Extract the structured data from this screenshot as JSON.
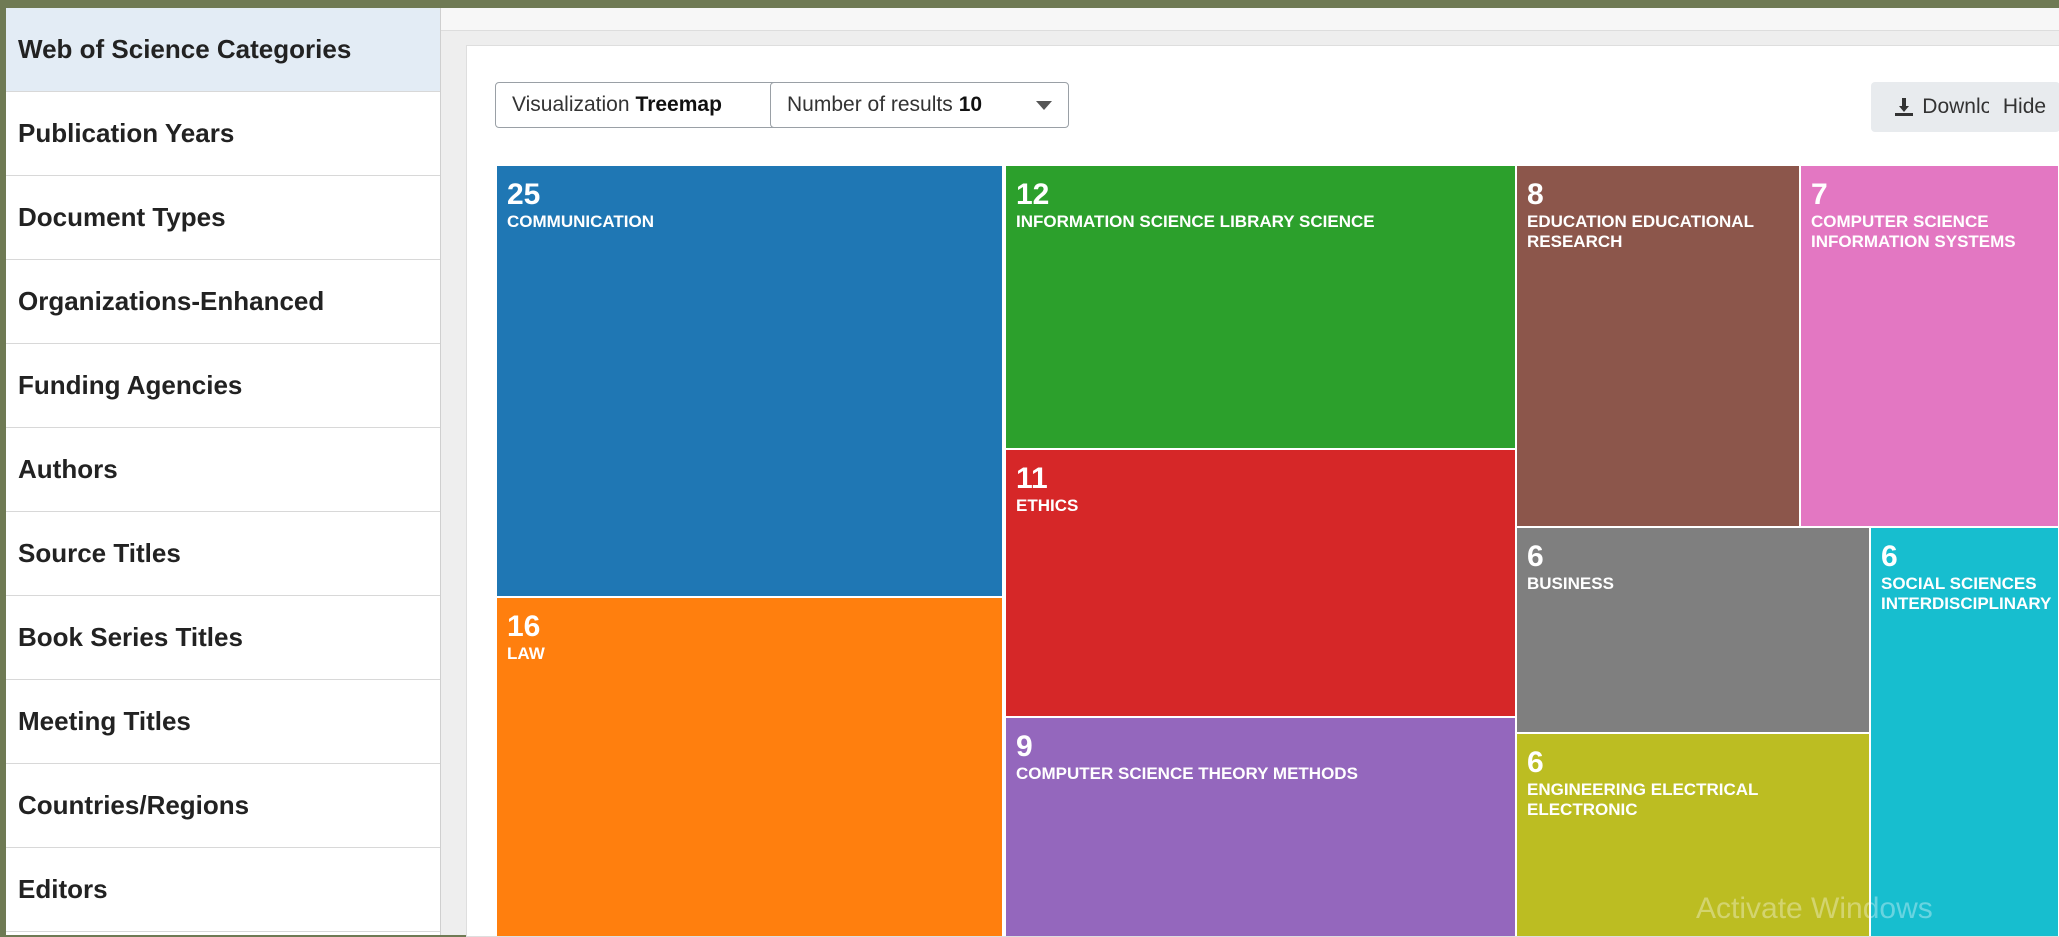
{
  "sidebar": {
    "items": [
      {
        "label": "Web of Science Categories",
        "active": true
      },
      {
        "label": "Publication Years"
      },
      {
        "label": "Document Types"
      },
      {
        "label": "Organizations-Enhanced"
      },
      {
        "label": "Funding Agencies"
      },
      {
        "label": "Authors"
      },
      {
        "label": "Source Titles"
      },
      {
        "label": "Book Series Titles"
      },
      {
        "label": "Meeting Titles"
      },
      {
        "label": "Countries/Regions"
      },
      {
        "label": "Editors"
      }
    ]
  },
  "controls": {
    "visualization_label": "Visualization",
    "visualization_value": "Treemap",
    "results_label": "Number of results",
    "results_value": "10",
    "download_label": "Download",
    "hide_label": "Hide"
  },
  "chart_data": {
    "type": "treemap",
    "items": [
      {
        "count": 25,
        "label": "COMMUNICATION",
        "color": "#1f77b4"
      },
      {
        "count": 16,
        "label": "LAW",
        "color": "#ff7f0e"
      },
      {
        "count": 12,
        "label": "INFORMATION SCIENCE LIBRARY SCIENCE",
        "color": "#2ca02c"
      },
      {
        "count": 11,
        "label": "ETHICS",
        "color": "#d62728"
      },
      {
        "count": 9,
        "label": "COMPUTER SCIENCE THEORY METHODS",
        "color": "#9467bd"
      },
      {
        "count": 8,
        "label": "EDUCATION EDUCATIONAL RESEARCH",
        "color": "#8c564b"
      },
      {
        "count": 7,
        "label": "COMPUTER SCIENCE INFORMATION SYSTEMS",
        "color": "#e377c2"
      },
      {
        "count": 6,
        "label": "BUSINESS",
        "color": "#7f7f7f"
      },
      {
        "count": 6,
        "label": "ENGINEERING ELECTRICAL ELECTRONIC",
        "color": "#bcbd22"
      },
      {
        "count": 6,
        "label": "SOCIAL SCIENCES INTERDISCIPLINARY",
        "color": "#17becf"
      }
    ]
  },
  "watermark": "Activate Windows"
}
